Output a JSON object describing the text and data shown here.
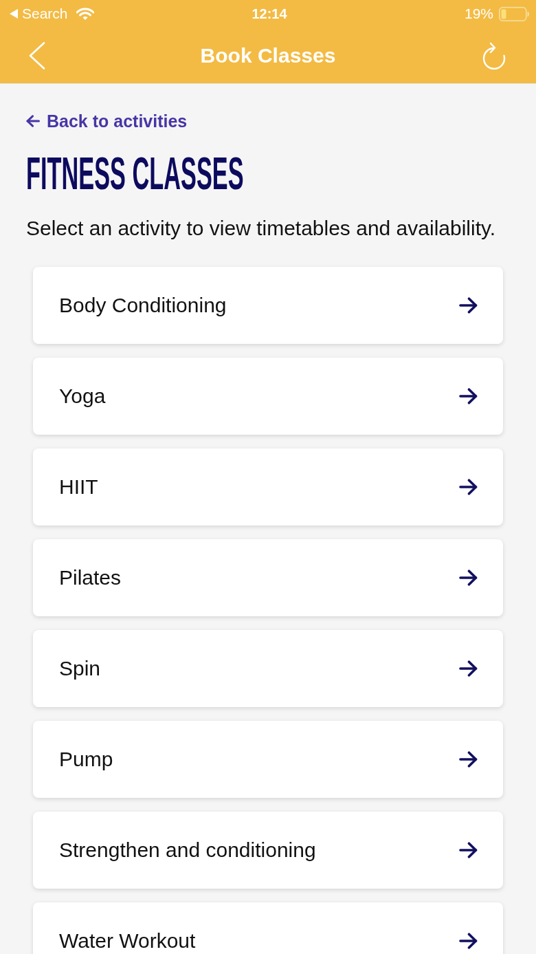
{
  "status_bar": {
    "back_app": "Search",
    "time": "12:14",
    "battery": "19%"
  },
  "nav_bar": {
    "title": "Book Classes"
  },
  "back_link": {
    "label": "Back to activities"
  },
  "heading": "FITNESS CLASSES",
  "intro": "Select an activity to view timetables and availability.",
  "activities": [
    "Body Conditioning",
    "Yoga",
    "HIIT",
    "Pilates",
    "Spin",
    "Pump",
    "Strengthen and conditioning",
    "Water Workout"
  ]
}
